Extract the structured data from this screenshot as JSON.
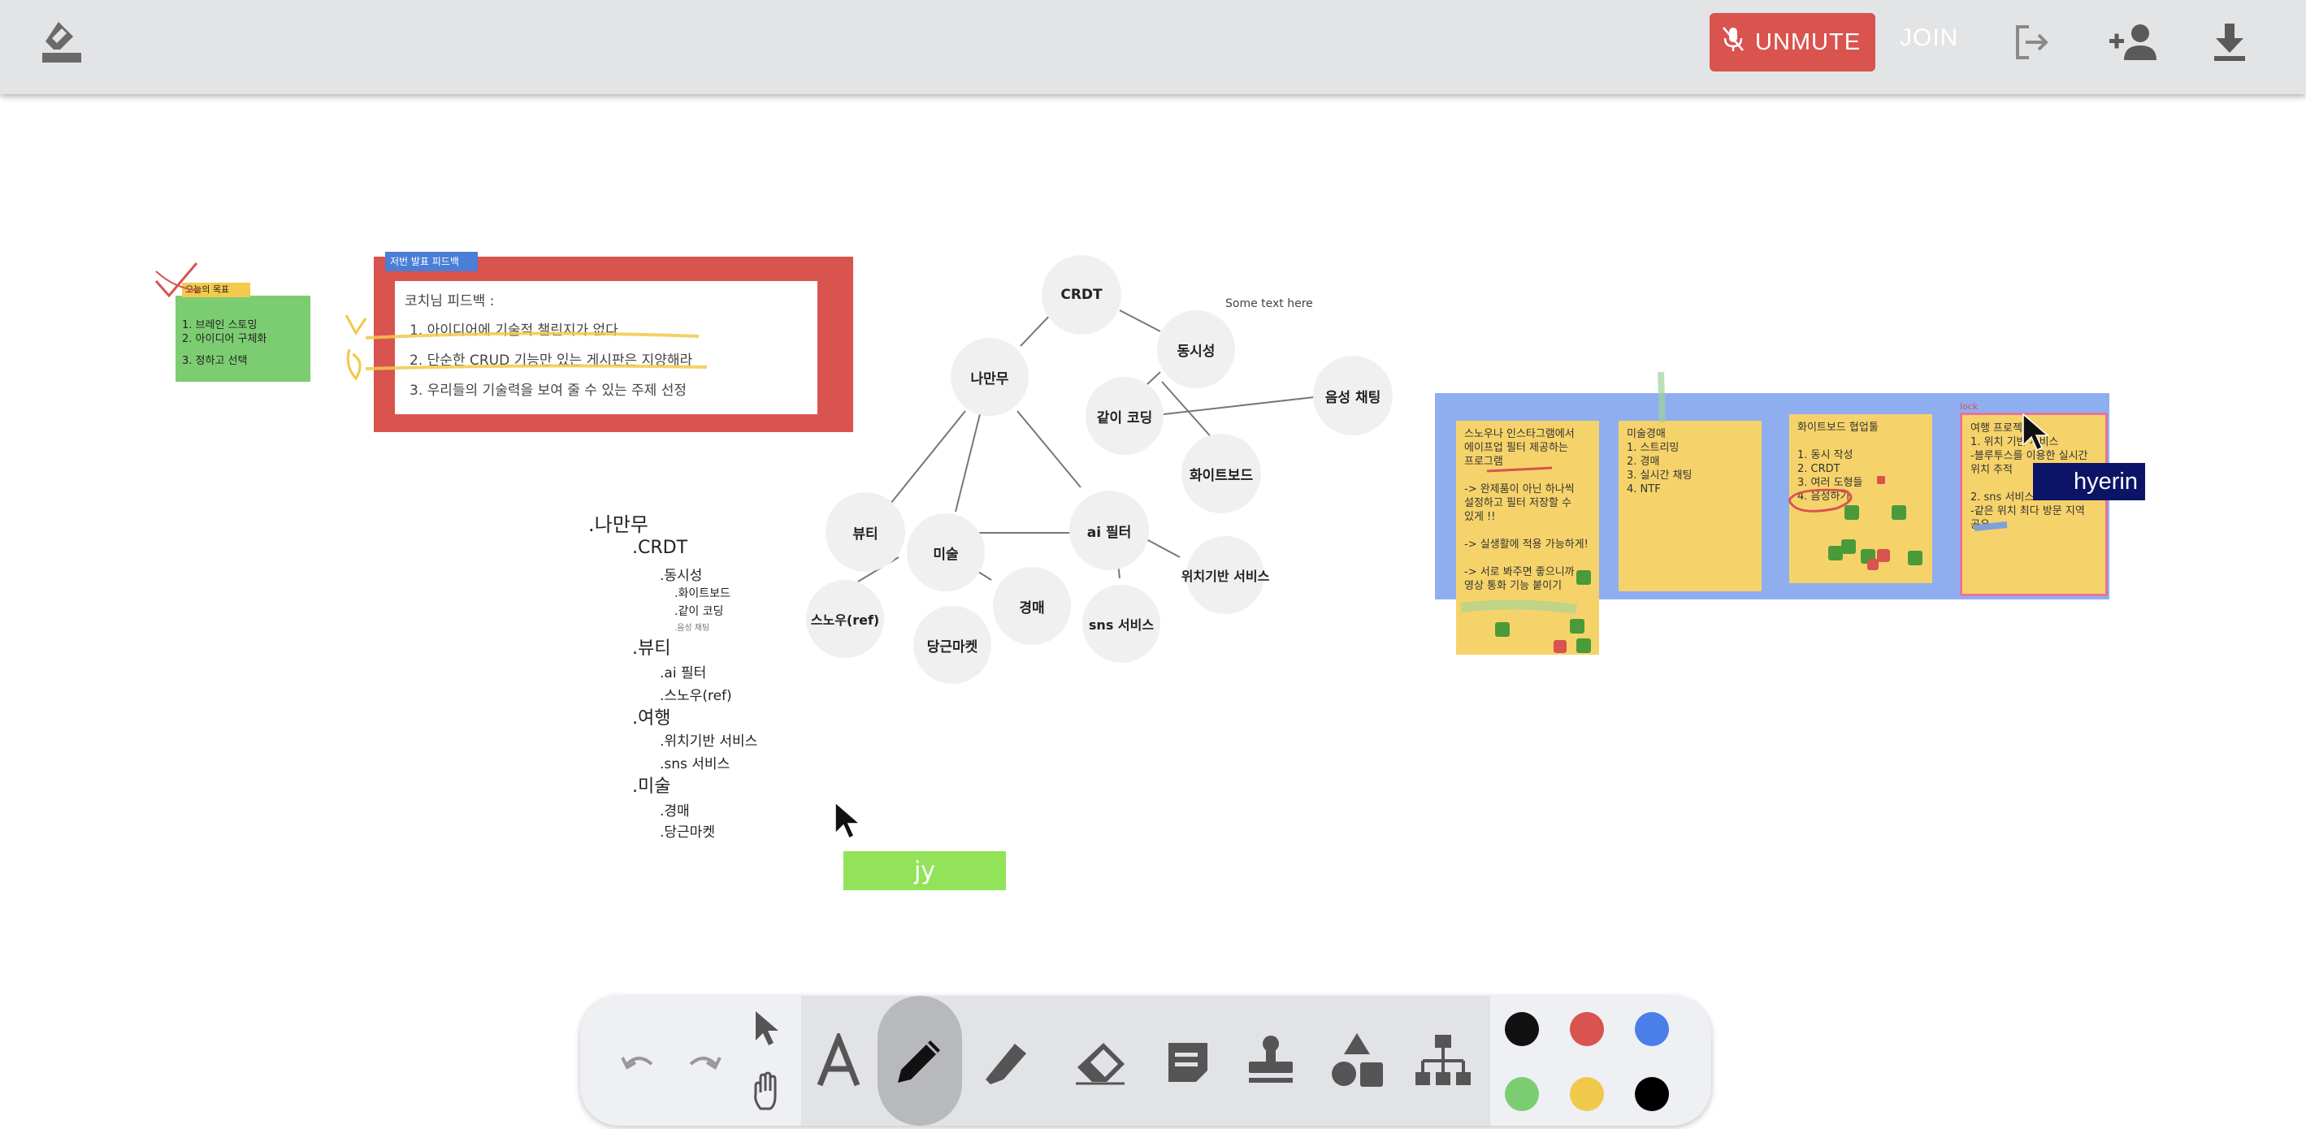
{
  "topbar": {
    "unmute_label": "UNMUTE",
    "join_label": "JOIN",
    "icons": [
      "eraser-board-icon",
      "mic-off-icon",
      "exit-icon",
      "add-person-icon",
      "download-icon"
    ]
  },
  "canvas": {
    "goal_note": {
      "tag": "오늘의 목표",
      "lines": [
        "1. 브레인 스토밍",
        "2. 아이디어 구체화",
        "3. 정하고 선택"
      ]
    },
    "feedback": {
      "tag": "저번 발표 피드백",
      "title": "코치님 피드백 :",
      "lines": [
        "1.  아이디어에 기술적 챌린지가 없다",
        "2.  단순한 CRUD 기능만 있는 게시판은 지양해라",
        "3.  우리들의 기술력을 보여 줄 수 있는 주제 선정"
      ]
    },
    "mindmap": {
      "nodes": [
        "CRDT",
        "동시성",
        "나만무",
        "같이 코딩",
        "음성 채팅",
        "화이트보드",
        "뷰티",
        "미술",
        "ai 필터",
        "위치기반 서비스",
        "스노우(ref)",
        "당근마켓",
        "경매",
        "sns 서비스"
      ],
      "floating_text": "Some text here"
    },
    "outline": {
      "root": ".나만무",
      "lines": [
        ".CRDT",
        ".동시성",
        ".화이트보드",
        ".같이 코딩",
        ".음성 채팅",
        ".뷰티",
        ".ai 필터",
        ".스노우(ref)",
        ".여행",
        ".위치기반 서비스",
        ".sns 서비스",
        ".미술",
        ".경매",
        ".당근마켓"
      ]
    },
    "board_notes": [
      {
        "lines": [
          "스노우나 인스타그램에서",
          "에이프업 필터 제공하는",
          "프로그램",
          "",
          "-> 완제품이 아닌 하나씩",
          "설정하고 필터 저장할 수",
          "있게 !!",
          "",
          "-> 실생활에 적용 가능하게!",
          "",
          "-> 서로 봐주면 좋으니까",
          "영상 통화 기능 붙이기"
        ]
      },
      {
        "lines": [
          "미술경매",
          "1. 스트리밍",
          "2. 경매",
          "3. 실시간 채팅",
          "4. NTF"
        ]
      },
      {
        "lines": [
          "화이트보드 협업툴",
          "",
          "1. 동시 작성",
          "2. CRDT",
          "3. 여러 도형들",
          "4. 음성하기"
        ]
      },
      {
        "lines": [
          "여행 프로젝트",
          "1. 위치 기반 서비스",
          "-블루투스를 이용한 실시간",
          "위치 추적",
          "",
          "2. sns 서비스",
          "-같은 위치 최다 방문 지역",
          "공유"
        ]
      }
    ],
    "cursor_labels": {
      "jy": "jy",
      "hyerin": "hyerin"
    },
    "lock_label": "lock"
  },
  "toolbar": {
    "tools": [
      "undo-icon",
      "redo-icon",
      "select-icon",
      "hand-icon",
      "text-icon",
      "pen-icon",
      "highlighter-icon",
      "eraser-icon",
      "sticky-note-icon",
      "stamp-icon",
      "shapes-icon",
      "mindmap-icon"
    ],
    "colors": [
      "#111111",
      "#d9534f",
      "#4a7ee8",
      "#7ccd72",
      "#f1c94a",
      "#000000"
    ]
  }
}
